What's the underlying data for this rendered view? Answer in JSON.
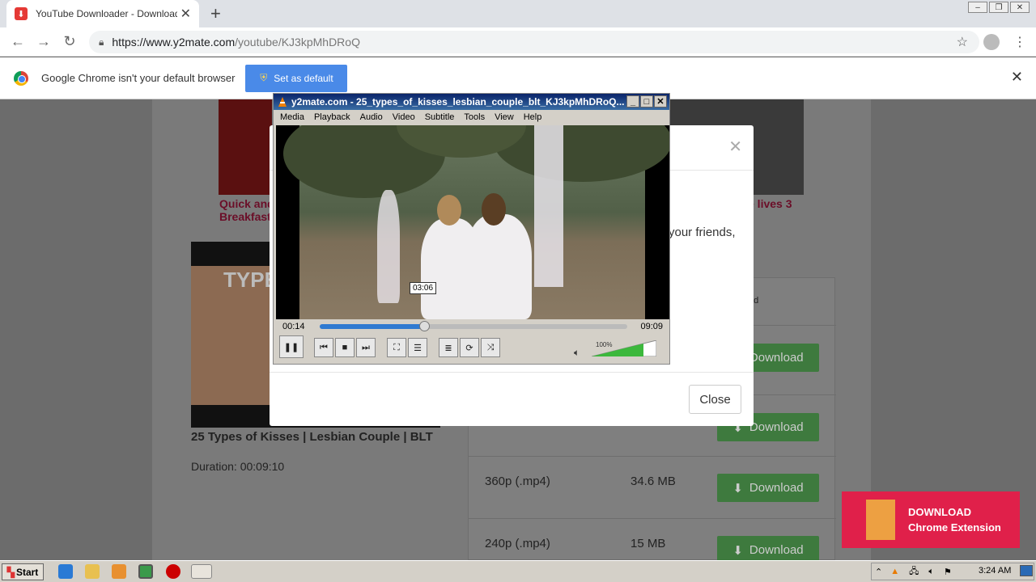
{
  "browser": {
    "tab_title": "YouTube Downloader - Download Vid",
    "url_host": "https://www.y2mate.com",
    "url_path": "/youtube/KJ3kpMhDRoQ",
    "infobar_text": "Google Chrome isn't your default browser",
    "set_default_label": "Set as default"
  },
  "page": {
    "link_left": "Quick and",
    "link_left2": "Breakfast",
    "link_right": "e lives 3",
    "video_title": "25 Types of Kisses | Lesbian Couple | BLT",
    "duration": "Duration: 00:09:10",
    "thumb_text": "TYPE",
    "header_cell_partial": "ad",
    "rows": [
      {
        "quality": "360p (.mp4)",
        "size": "34.6 MB",
        "button": "Download"
      },
      {
        "quality": "240p (.mp4)",
        "size": "15 MB",
        "button": "Download"
      }
    ],
    "download_label": "Download"
  },
  "modal": {
    "message_partial": "your friends,",
    "close_label": "Close"
  },
  "vlc": {
    "title": "y2mate.com - 25_types_of_kisses_lesbian_couple_blt_KJ3kpMhDRoQ...",
    "menu": [
      "Media",
      "Playback",
      "Audio",
      "Video",
      "Subtitle",
      "Tools",
      "View",
      "Help"
    ],
    "elapsed": "00:14",
    "total": "09:09",
    "hover_time": "03:06",
    "volume_label": "100%",
    "progress": 0.34
  },
  "ad": {
    "line1": "DOWNLOAD",
    "line2": "Chrome Extension"
  },
  "taskbar": {
    "start_label": "Start",
    "clock": "3:24 AM"
  }
}
